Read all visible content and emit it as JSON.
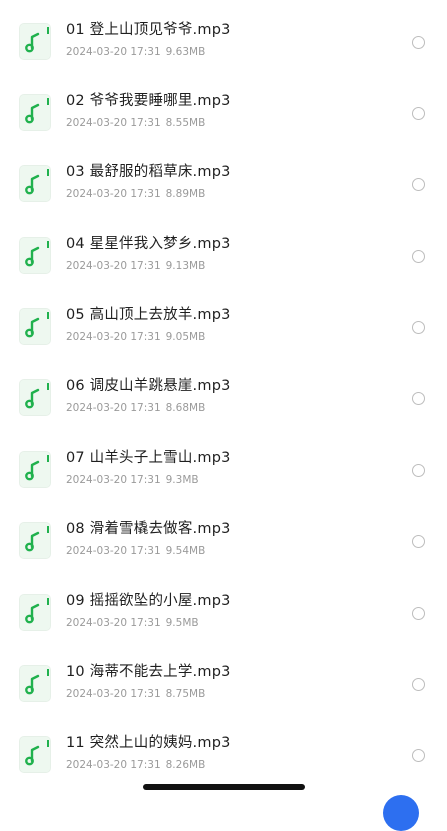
{
  "files": [
    {
      "name": "01 登上山顶见爷爷.mp3",
      "date": "2024-03-20 17:31",
      "size": "9.63MB",
      "icon": "music-file-icon"
    },
    {
      "name": "02 爷爷我要睡哪里.mp3",
      "date": "2024-03-20 17:31",
      "size": "8.55MB",
      "icon": "music-file-icon"
    },
    {
      "name": "03 最舒服的稻草床.mp3",
      "date": "2024-03-20 17:31",
      "size": "8.89MB",
      "icon": "music-file-icon"
    },
    {
      "name": "04 星星伴我入梦乡.mp3",
      "date": "2024-03-20 17:31",
      "size": "9.13MB",
      "icon": "music-file-icon"
    },
    {
      "name": "05 高山顶上去放羊.mp3",
      "date": "2024-03-20 17:31",
      "size": "9.05MB",
      "icon": "music-file-icon"
    },
    {
      "name": "06 调皮山羊跳悬崖.mp3",
      "date": "2024-03-20 17:31",
      "size": "8.68MB",
      "icon": "music-file-icon"
    },
    {
      "name": "07 山羊头子上雪山.mp3",
      "date": "2024-03-20 17:31",
      "size": "9.3MB",
      "icon": "music-file-icon"
    },
    {
      "name": "08 滑着雪橇去做客.mp3",
      "date": "2024-03-20 17:31",
      "size": "9.54MB",
      "icon": "music-file-icon"
    },
    {
      "name": "09 摇摇欲坠的小屋.mp3",
      "date": "2024-03-20 17:31",
      "size": "9.5MB",
      "icon": "music-file-icon"
    },
    {
      "name": "10 海蒂不能去上学.mp3",
      "date": "2024-03-20 17:31",
      "size": "8.75MB",
      "icon": "music-file-icon"
    },
    {
      "name": "11 突然上山的姨妈.mp3",
      "date": "2024-03-20 17:31",
      "size": "8.26MB",
      "icon": "music-file-icon"
    }
  ],
  "colors": {
    "icon_bg": "#eef8f0",
    "icon_note": "#20b14d",
    "meta_text": "#9a9a9a",
    "accent": "#2d6ff0"
  }
}
